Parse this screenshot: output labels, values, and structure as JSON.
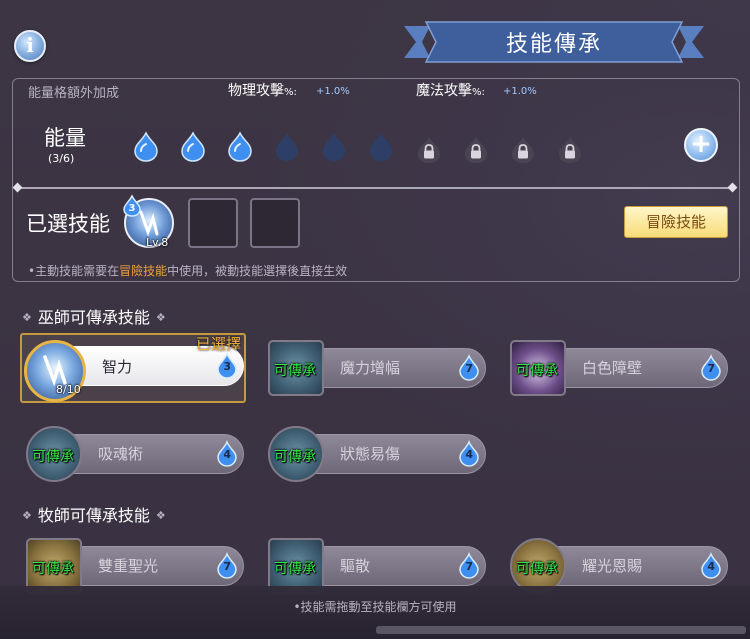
{
  "title": "技能傳承",
  "info_icon": "info-icon",
  "bonus": {
    "label": "能量格額外加成",
    "physical_label": "物理攻擊",
    "physical_pct": "%:",
    "physical_value": "+1.0%",
    "magic_label": "魔法攻擊",
    "magic_pct": "%:",
    "magic_value": "+1.0%"
  },
  "energy": {
    "label": "能量",
    "count": "(3/6)",
    "filled": 3,
    "empty": 3,
    "locked": 4
  },
  "selected_skills": {
    "label": "已選技能",
    "skill_level": "Lv.8",
    "skill_cost": "3",
    "adventure_button": "冒險技能",
    "hint_prefix": "•主動技能需要在",
    "hint_highlight": "冒險技能",
    "hint_suffix": "中使用，被動技能選擇後直接生效"
  },
  "sections": [
    {
      "title": "巫師可傳承技能",
      "cards": [
        {
          "name": "智力",
          "cost": "3",
          "level": "8/10",
          "selected": true,
          "tag": "已選擇"
        },
        {
          "name": "魔力增幅",
          "cost": "7",
          "inherit": "可傳承"
        },
        {
          "name": "白色障壁",
          "cost": "7",
          "inherit": "可傳承"
        },
        {
          "name": "吸魂術",
          "cost": "4",
          "inherit": "可傳承"
        },
        {
          "name": "狀態易傷",
          "cost": "4",
          "inherit": "可傳承"
        }
      ]
    },
    {
      "title": "牧師可傳承技能",
      "cards": [
        {
          "name": "雙重聖光",
          "cost": "7",
          "inherit": "可傳承"
        },
        {
          "name": "驅散",
          "cost": "7",
          "inherit": "可傳承"
        },
        {
          "name": "耀光恩賜",
          "cost": "4",
          "inherit": "可傳承"
        }
      ]
    }
  ],
  "footer": "•技能需拖動至技能欄方可使用",
  "colors": {
    "accent_gold": "#f3b13d",
    "inherit_green": "#35e34a",
    "highlight_orange": "#f2a13a",
    "stat_blue": "#9fc8ff"
  }
}
